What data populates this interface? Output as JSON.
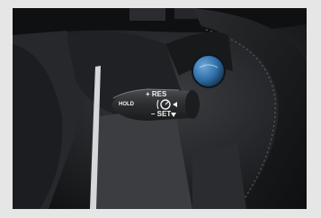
{
  "stalk": {
    "res_label": "+ RES",
    "hold_label": "HOLD",
    "set_label": "– SET"
  },
  "icons": {
    "cruise_control_icon": "cruise-control-gauge",
    "distance_arrow_icon": "arrow-left",
    "set_arrow_icon": "triangle-down"
  },
  "colors": {
    "stalk_body": "#2b2c2e",
    "button_blue": "#2e6ea6",
    "dashboard": "#1d1e20",
    "frame_border": "#e6e6e6"
  }
}
